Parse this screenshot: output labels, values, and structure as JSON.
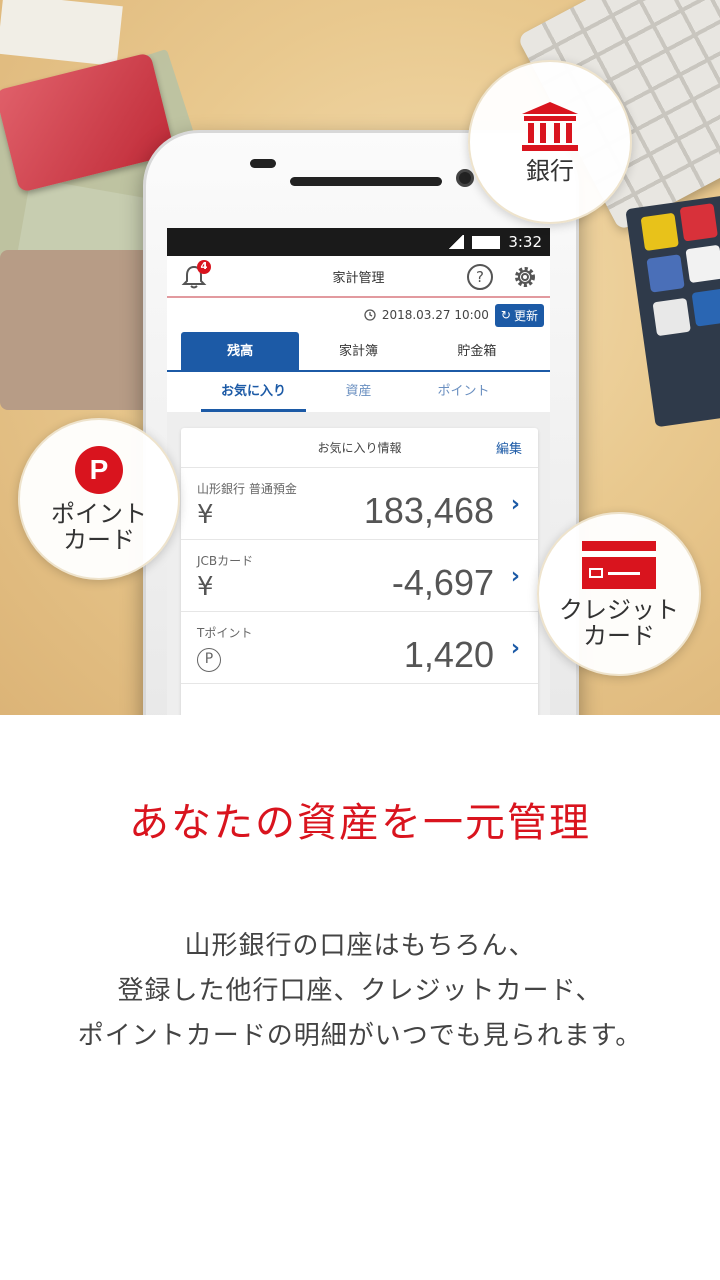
{
  "phone": {
    "status_time": "3:32",
    "app_title": "家計管理",
    "notification_count": "4",
    "help_label": "?",
    "updated_at": "2018.03.27 10:00",
    "refresh_label": "更新",
    "tabs": [
      {
        "label": "残高",
        "active": true
      },
      {
        "label": "家計簿",
        "active": false
      },
      {
        "label": "貯金箱",
        "active": false
      }
    ],
    "subtabs": [
      {
        "label": "お気に入り",
        "active": true
      },
      {
        "label": "資産",
        "active": false
      },
      {
        "label": "ポイント",
        "active": false
      }
    ],
    "card": {
      "title": "お気に入り情報",
      "edit_label": "編集",
      "rows": [
        {
          "label": "山形銀行 普通預金",
          "unit": "¥",
          "value": "183,468"
        },
        {
          "label": "JCBカード",
          "unit": "¥",
          "value": "-4,697"
        },
        {
          "label": "Tポイント",
          "unit": "P",
          "value": "1,420"
        }
      ]
    }
  },
  "badges": {
    "bank": {
      "label": "銀行",
      "icon": "bank-icon"
    },
    "point": {
      "line1": "ポイント",
      "line2": "カード",
      "icon": "point-card-icon",
      "icon_letter": "P"
    },
    "credit": {
      "line1": "クレジット",
      "line2": "カード",
      "icon": "credit-card-icon"
    }
  },
  "headline": "あなたの資産を一元管理",
  "description": {
    "line1": "山形銀行の口座はもちろん、",
    "line2": "登録した他行口座、クレジットカード、",
    "line3": "ポイントカードの明細がいつでも見られます。"
  },
  "colors": {
    "brand_red": "#d9141e",
    "brand_blue": "#1c5aa6"
  }
}
